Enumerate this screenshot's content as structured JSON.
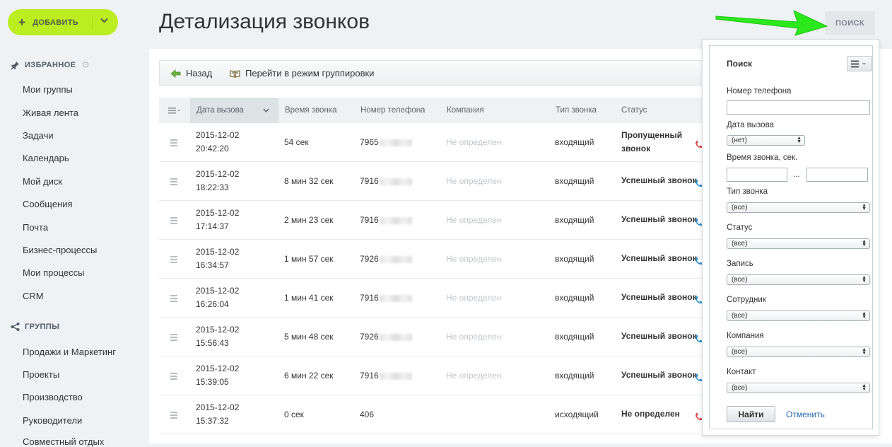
{
  "add_button": {
    "label": "ДОБАВИТЬ"
  },
  "sidebar": {
    "favorites_label": "ИЗБРАННОЕ",
    "favorites": [
      "Мои группы",
      "Живая лента",
      "Задачи",
      "Календарь",
      "Мой диск",
      "Сообщения",
      "Почта",
      "Бизнес-процессы",
      "Мои процессы",
      "CRM"
    ],
    "groups_label": "ГРУППЫ",
    "groups": [
      "Продажи и Маркетинг",
      "Проекты",
      "Производство",
      "Руководители",
      "Совместный отдых"
    ]
  },
  "page": {
    "title": "Детализация звонков",
    "search_button": "ПОИСК"
  },
  "toolbar": {
    "back": "Назад",
    "grouping": "Перейти в режим группировки"
  },
  "table": {
    "columns": [
      "Дата вызова",
      "Время звонка",
      "Номер телефона",
      "Компания",
      "Тип звонка",
      "Статус"
    ],
    "rows": [
      {
        "date": "2015-12-02",
        "time": "20:42:20",
        "duration": "54 сек",
        "phone": "7965",
        "company": "Не определен",
        "type": "входящий",
        "status_l1": "Пропущенный",
        "status_l2": "звонок",
        "blurred": true
      },
      {
        "date": "2015-12-02",
        "time": "18:22:33",
        "duration": "8 мин 32 сек",
        "phone": "7916",
        "company": "Не определен",
        "type": "входящий",
        "status_l1": "Успешный звонок",
        "status_l2": "",
        "blurred": true
      },
      {
        "date": "2015-12-02",
        "time": "17:14:37",
        "duration": "2 мин 23 сек",
        "phone": "7916",
        "company": "Не определен",
        "type": "входящий",
        "status_l1": "Успешный звонок",
        "status_l2": "",
        "blurred": true
      },
      {
        "date": "2015-12-02",
        "time": "16:34:57",
        "duration": "1 мин 57 сек",
        "phone": "7926",
        "company": "Не определен",
        "type": "входящий",
        "status_l1": "Успешный звонок",
        "status_l2": "",
        "blurred": true
      },
      {
        "date": "2015-12-02",
        "time": "16:26:04",
        "duration": "1 мин 41 сек",
        "phone": "7916",
        "company": "Не определен",
        "type": "входящий",
        "status_l1": "Успешный звонок",
        "status_l2": "",
        "blurred": true
      },
      {
        "date": "2015-12-02",
        "time": "15:56:43",
        "duration": "5 мин 48 сек",
        "phone": "7926",
        "company": "Не определен",
        "type": "входящий",
        "status_l1": "Успешный звонок",
        "status_l2": "",
        "blurred": true
      },
      {
        "date": "2015-12-02",
        "time": "15:39:05",
        "duration": "6 мин 22 сек",
        "phone": "7916",
        "company": "Не определен",
        "type": "входящий",
        "status_l1": "Успешный звонок",
        "status_l2": "",
        "blurred": true
      },
      {
        "date": "2015-12-02",
        "time": "15:37:32",
        "duration": "0 сек",
        "phone": "406",
        "company": "",
        "type": "исходящий",
        "status_l1": "Не определен",
        "status_l2": "",
        "blurred": false
      }
    ]
  },
  "search_panel": {
    "title": "Поиск",
    "phone_label": "Номер телефона",
    "date_label": "Дата вызова",
    "date_value": "(нет)",
    "duration_label": "Время звонка, сек.",
    "duration_sep": "...",
    "type_label": "Тип звонка",
    "status_label": "Статус",
    "record_label": "Запись",
    "employee_label": "Сотрудник",
    "company_label": "Компания",
    "contact_label": "Контакт",
    "all_value": "(все)",
    "find_button": "Найти",
    "cancel_link": "Отменить"
  },
  "colors": {
    "add_button": "#bbed21",
    "arrow": "#2ee81e",
    "link": "#2067b0",
    "phone_incoming": "#2f8ecf",
    "phone_missed": "#e04848"
  }
}
